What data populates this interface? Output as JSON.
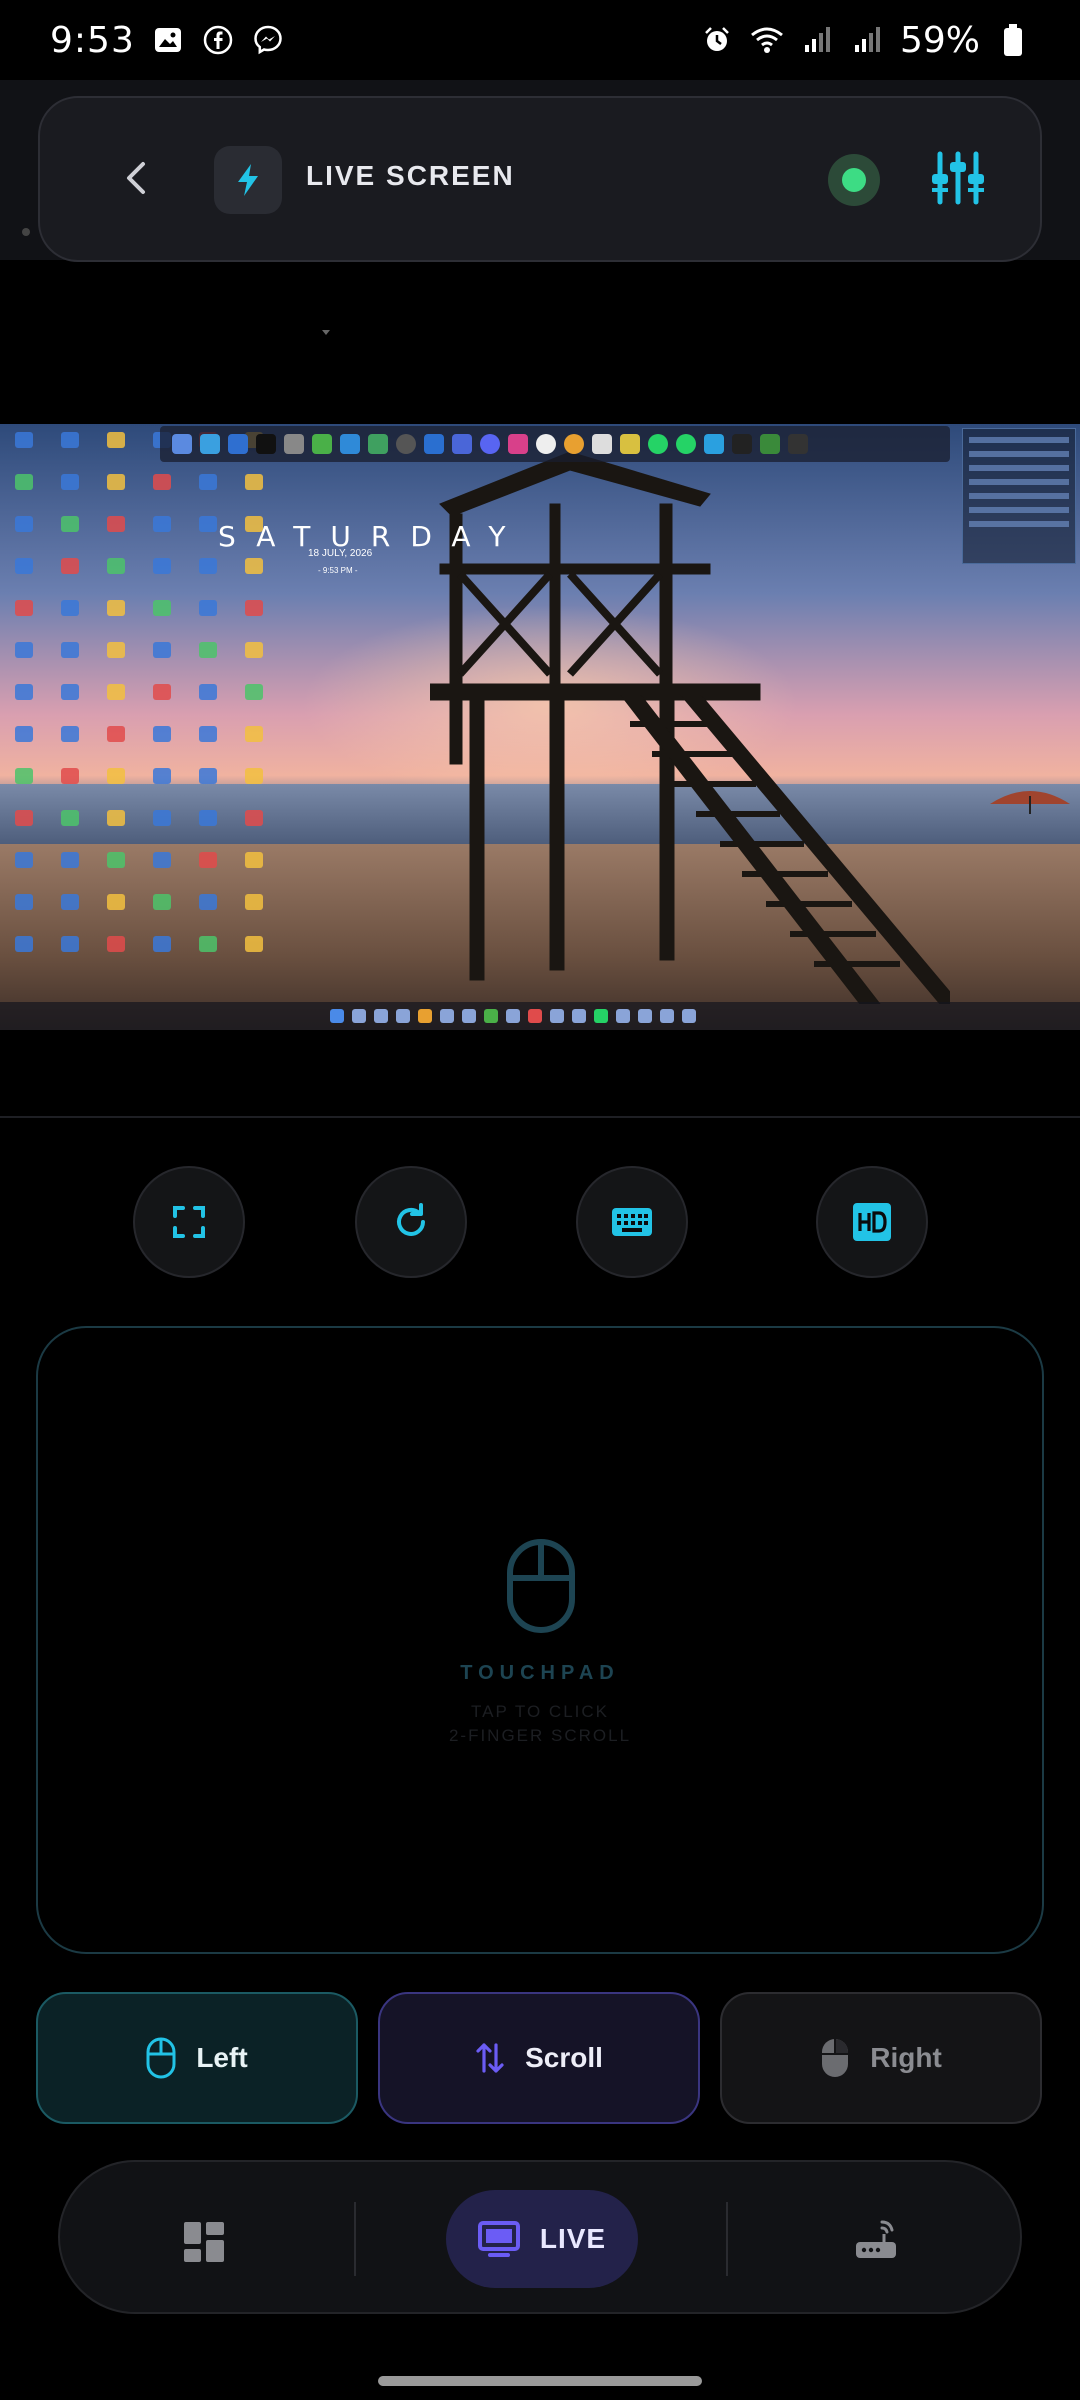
{
  "status_bar": {
    "time": "9:53",
    "battery": "59%",
    "left_icons": [
      "gallery-icon",
      "facebook-icon",
      "messenger-icon"
    ],
    "right_icons": [
      "alarm-icon",
      "wifi-icon",
      "signal-icon",
      "signal-icon",
      "battery-icon"
    ]
  },
  "header": {
    "title": "LIVE SCREEN",
    "status": "connected",
    "icons": [
      "back-icon",
      "bolt-icon",
      "live-status-dot",
      "equalizer-icon"
    ]
  },
  "remote_screen": {
    "clock_word": "SATURDAY",
    "date": "18 JULY, 2026",
    "time": "- 9:53 PM -"
  },
  "controls": [
    {
      "name": "fullscreen",
      "icon": "fullscreen-icon"
    },
    {
      "name": "refresh",
      "icon": "refresh-icon"
    },
    {
      "name": "keyboard",
      "icon": "keyboard-icon"
    },
    {
      "name": "hd",
      "icon": "hd-icon"
    }
  ],
  "touchpad": {
    "label": "TOUCHPAD",
    "hint_1": "TAP TO CLICK",
    "hint_2": "2-FINGER SCROLL"
  },
  "mouse_buttons": {
    "left": "Left",
    "scroll": "Scroll",
    "right": "Right"
  },
  "bottom_nav": {
    "live_label": "LIVE",
    "active": "live"
  },
  "colors": {
    "accent_cyan": "#22c3e6",
    "accent_purple": "#6b5cf5",
    "live_green": "#3ddc84",
    "background": "#000000"
  }
}
